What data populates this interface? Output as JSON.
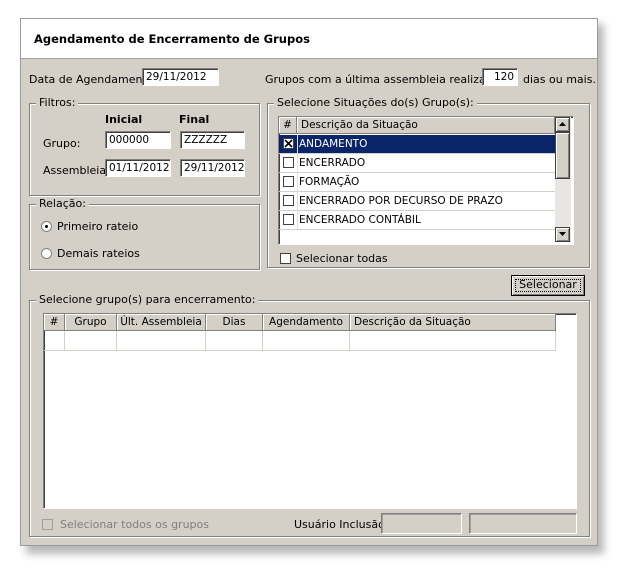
{
  "window": {
    "title": "Agendamento de Encerramento de Grupos"
  },
  "scheduling": {
    "date_label": "Data de Agendamento:",
    "date_value": "29/11/2012",
    "groups_last_label": "Grupos com a última assembleia realizada a",
    "days_value": "120",
    "days_suffix": "dias ou mais."
  },
  "filters": {
    "title": "Filtros:",
    "col_initial": "Inicial",
    "col_final": "Final",
    "group_label": "Grupo:",
    "group_initial": "000000",
    "group_final": "ZZZZZZ",
    "assembly_label": "Assembleia:",
    "assembly_initial": "01/11/2012",
    "assembly_final": "29/11/2012"
  },
  "relation": {
    "title": "Relação:",
    "options": [
      {
        "label": "Primeiro rateio",
        "selected": true
      },
      {
        "label": "Demais rateios",
        "selected": false
      }
    ]
  },
  "situations": {
    "title": "Selecione Situações do(s) Grupo(s):",
    "col_hash": "#",
    "col_desc": "Descrição da Situação",
    "rows": [
      {
        "label": "ANDAMENTO",
        "checked": true
      },
      {
        "label": "ENCERRADO",
        "checked": false
      },
      {
        "label": "FORMAÇÃO",
        "checked": false
      },
      {
        "label": "ENCERRADO POR DECURSO DE PRAZO",
        "checked": false
      },
      {
        "label": "ENCERRADO CONTÁBIL",
        "checked": false
      }
    ],
    "select_all_label": "Selecionar todas"
  },
  "select_button": "Selecionar",
  "closure": {
    "title": "Selecione grupo(s) para encerramento:",
    "columns": [
      "#",
      "Grupo",
      "Últ. Assembleia",
      "Dias",
      "Agendamento",
      "Descrição da Situação"
    ],
    "select_all_label": "Selecionar todos os grupos",
    "user_label": "Usuário Inclusão:",
    "user_value_1": "",
    "user_value_2": ""
  },
  "colors": {
    "selection": "#0a246a",
    "face": "#d4d0c8"
  }
}
